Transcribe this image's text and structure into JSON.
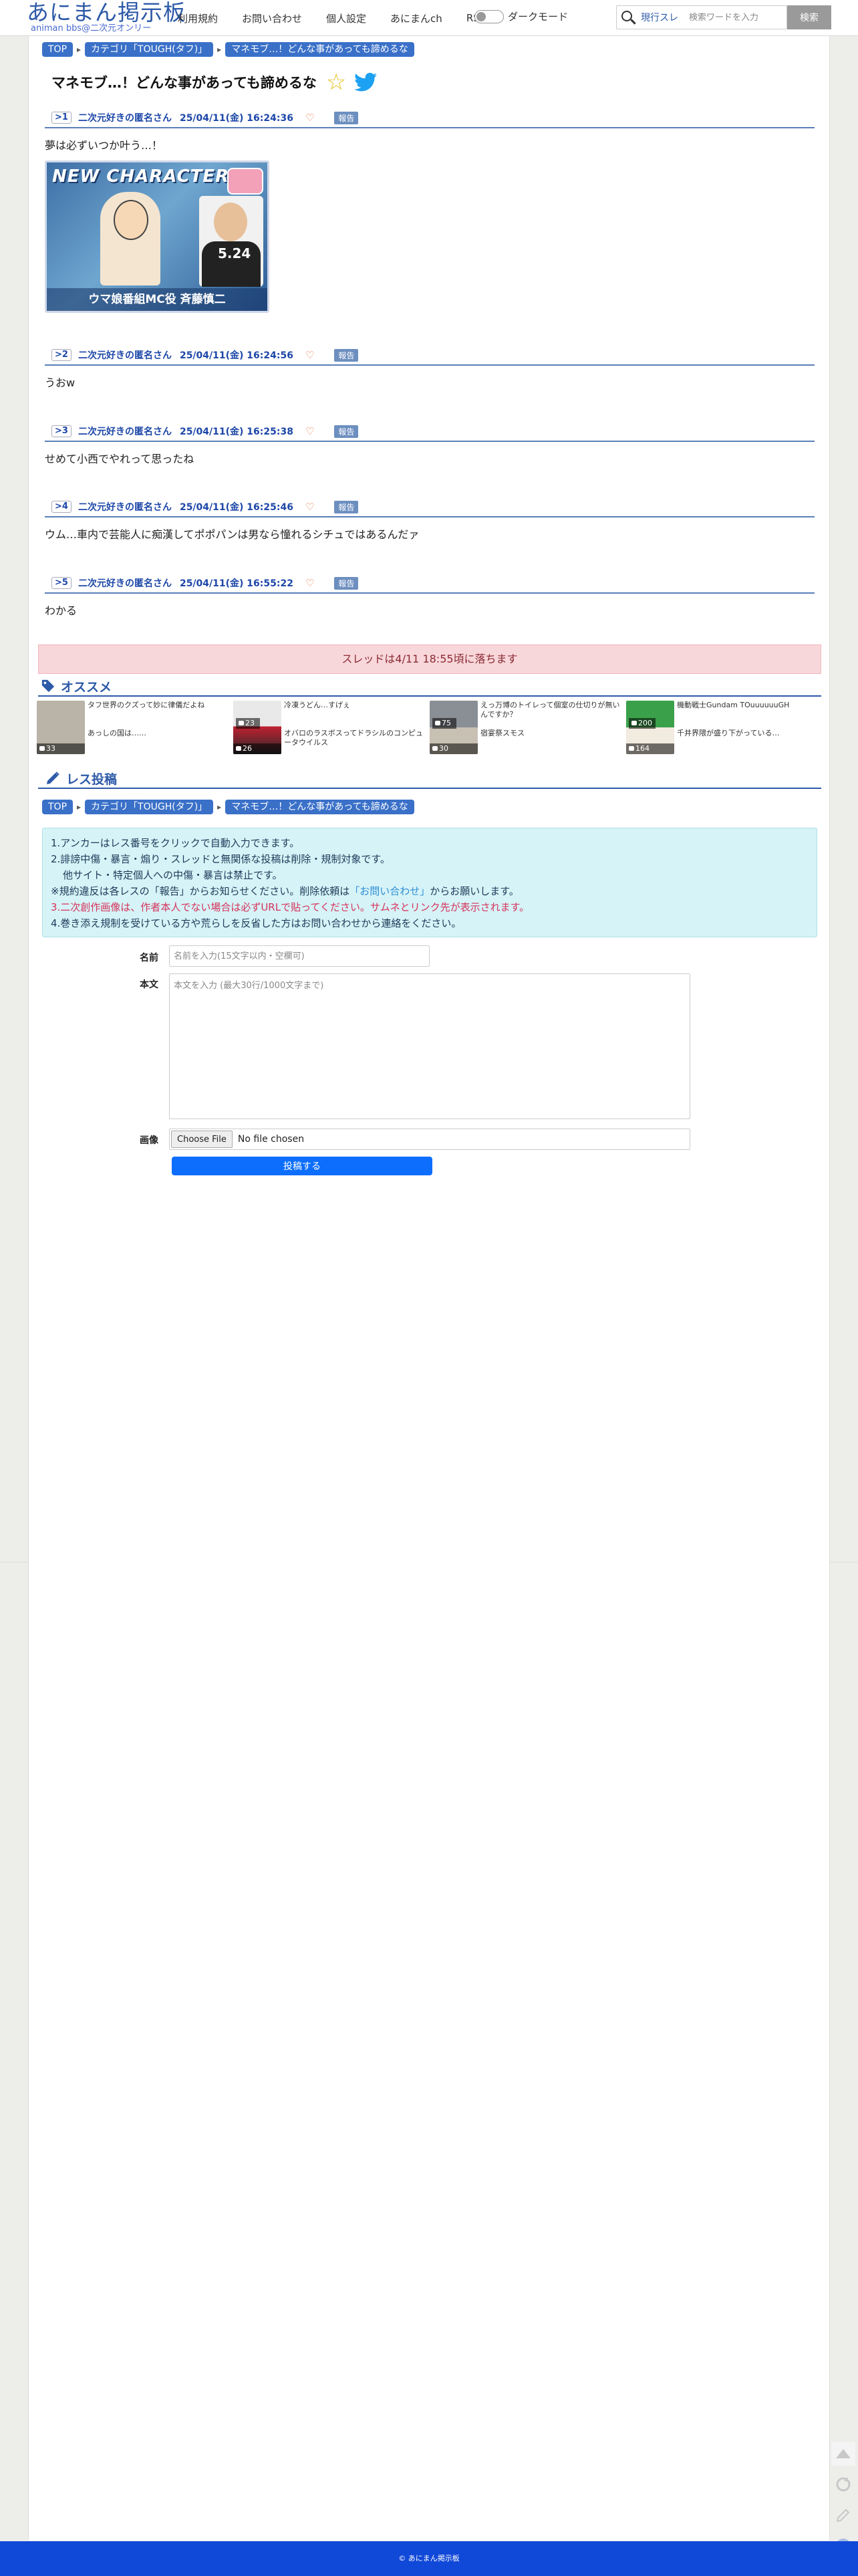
{
  "header": {
    "logo_main": "あにまん掲示板",
    "logo_sub": "animan bbs@二次元オンリー",
    "nav": [
      "利用規約",
      "お問い合わせ",
      "個人設定",
      "あにまんch",
      "RSS"
    ],
    "dark_mode_label": "ダークモード",
    "search_scope": "現行スレ",
    "search_placeholder": "検索ワードを入力",
    "search_button": "検索"
  },
  "breadcrumb": [
    "TOP",
    "カテゴリ「TOUGH(タフ)」",
    "マネモブ…！どんな事があっても諦めるな"
  ],
  "thread": {
    "title": "マネモブ…！どんな事があっても諦めるな"
  },
  "posts": [
    {
      "no": ">1",
      "author": "二次元好きの匿名さん",
      "date": "25/04/11(金) 16:24:36",
      "report": "報告",
      "body": "夢は必ずいつか叶う…！",
      "image": {
        "title": "NEW CHARACTER",
        "date": "5.24",
        "caption": "ウマ娘番組MC役 斉藤慎二"
      }
    },
    {
      "no": ">2",
      "author": "二次元好きの匿名さん",
      "date": "25/04/11(金) 16:24:56",
      "report": "報告",
      "body": "うおw"
    },
    {
      "no": ">3",
      "author": "二次元好きの匿名さん",
      "date": "25/04/11(金) 16:25:38",
      "report": "報告",
      "body": "せめて小西でやれって思ったね"
    },
    {
      "no": ">4",
      "author": "二次元好きの匿名さん",
      "date": "25/04/11(金) 16:25:46",
      "report": "報告",
      "body": "ウム…車内で芸能人に痴漢してポポパンは男なら憧れるシチュではあるんだァ"
    },
    {
      "no": ">5",
      "author": "二次元好きの匿名さん",
      "date": "25/04/11(金) 16:55:22",
      "report": "報告",
      "body": "わかる"
    }
  ],
  "fall_notice": "スレッドは4/11 18:55頃に落ちます",
  "recommend": {
    "title": "オススメ",
    "items": [
      {
        "title": "タフ世界のクズって妙に律儀だよね",
        "title2": "あっしの国は……",
        "count": "33",
        "thumb_color": "#b9b3a8"
      },
      {
        "title": "冷凍うどん…すげぇ",
        "title2": "オバロのラスボスってドラシルのコンピュータウイルス",
        "count": "26",
        "thumb_color": "#d8d8d8"
      },
      {
        "title": "えっ万博のトイレって個室の仕切りが無いんですか？",
        "title2": "宿宴祭スモス",
        "count": "30",
        "thumb_color": "#8a8f96"
      },
      {
        "title": "機動戦士Gundam TOuuuuuuGH",
        "title2": "千井界隈が盛り下がっている…",
        "count": "164",
        "thumb_color": "#3aa14a"
      }
    ],
    "extra_counts": [
      "23",
      "75",
      "200"
    ]
  },
  "post_form": {
    "title": "レス投稿",
    "info_lines": [
      "1.アンカーはレス番号をクリックで自動入力できます。",
      "2.誹謗中傷・暴言・煽り・スレッドと無関係な投稿は削除・規制対象です。",
      "他サイト・特定個人への中傷・暴言は禁止です。",
      "※規約違反は各レスの「報告」からお知らせください。削除依頼は",
      "「お問い合わせ」",
      "からお願いします。",
      "3.二次創作画像は、作者本人でない場合は必ずURLで貼ってください。サムネとリンク先が表示されます。",
      "4.巻き添え規制を受けている方や荒らしを反省した方はお問い合わせから連絡をください。"
    ],
    "name_label": "名前",
    "name_placeholder": "名前を入力(15文字以内・空欄可)",
    "body_label": "本文",
    "body_placeholder": "本文を入力 (最大30行/1000文字まで)",
    "image_label": "画像",
    "file_button": "Choose File",
    "file_status": "No file chosen",
    "submit": "投稿する"
  },
  "footer": "© あにまん掲示板",
  "colors": {
    "accent": "#2e5aa8",
    "footer": "#1048d8",
    "submit": "#0d6efd",
    "notice_bg": "#f8d7da",
    "info_bg": "#d6f3f7"
  }
}
